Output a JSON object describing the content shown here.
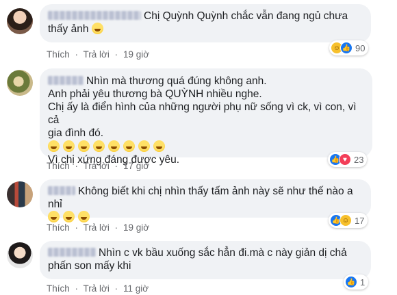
{
  "comments": [
    {
      "text": "Chị Quỳnh Quỳnh chắc vẫn đang ngủ chưa thấy ảnh",
      "emoji_count": 1,
      "actions": {
        "like": "Thích",
        "reply": "Trả lời",
        "time": "19 giờ"
      },
      "reactions": {
        "icons": [
          "haha",
          "like"
        ],
        "count": "90"
      }
    },
    {
      "text": "Nhìn mà thương quá đúng không anh. Anh phải yêu thương bà QUỲNH nhiều nghe. Chị ấy là điển hình của những người phụ nữ sống vì ck, vì con, vì cả gia đình đó.",
      "line1": "Nhìn mà thương quá đúng không anh.",
      "line2": "Anh phải yêu thương bà QUỲNH nhiều nghe.",
      "line3": "Chị ấy là điển hình của những người phụ nữ sống vì ck, vì con, vì cả",
      "line4": "gia đình đó.",
      "line6": "Vì chị xứng đáng được yêu.",
      "emoji_count": 8,
      "actions": {
        "like": "Thích",
        "reply": "Trả lời",
        "time": "17 giờ"
      },
      "reactions": {
        "icons": [
          "like",
          "love"
        ],
        "count": "23"
      }
    },
    {
      "text": "Không biết khi chị nhìn thấy tấm ảnh này sẽ như thế nào a nhỉ",
      "emoji_count": 3,
      "actions": {
        "like": "Thích",
        "reply": "Trả lời",
        "time": "19 giờ"
      },
      "reactions": {
        "icons": [
          "like",
          "haha"
        ],
        "count": "17"
      }
    },
    {
      "line1": "Nhìn c vk bầu xuống sắc hẳn đi.mà c này giản dị chả",
      "line2": "phấn son mấy khi",
      "actions": {
        "like": "Thích",
        "reply": "Trả lời",
        "time": "11 giờ"
      },
      "reactions": {
        "icons": [
          "like"
        ],
        "count": "1"
      }
    }
  ],
  "icons": {
    "like": "thumbs-up-icon",
    "haha": "laughing-face-icon",
    "love": "heart-icon"
  },
  "colors": {
    "bubble": "#f0f2f5",
    "action_text": "#65676b",
    "like_blue": "#1877f2",
    "love_red": "#f33e58",
    "haha_yellow": "#f7c02c"
  }
}
